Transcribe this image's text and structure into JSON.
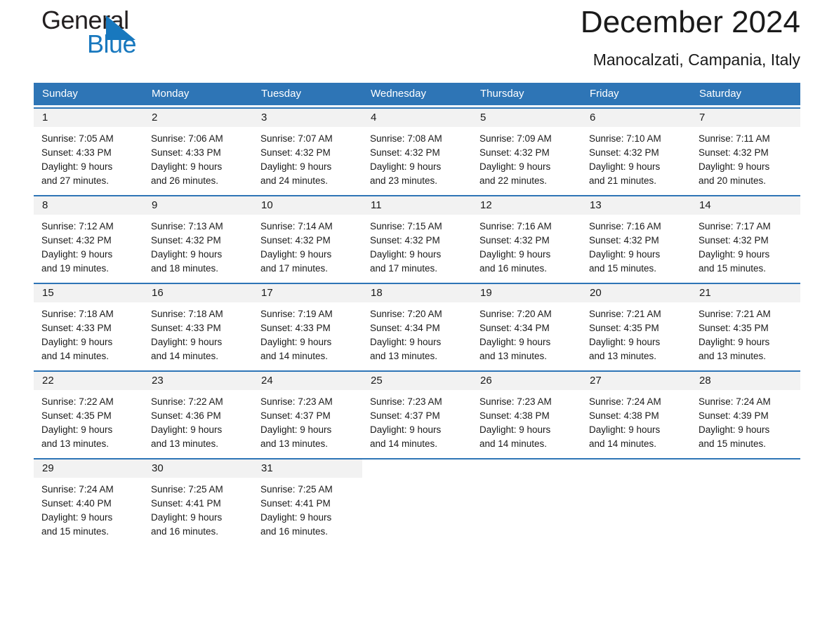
{
  "logo": {
    "text_primary": "General",
    "text_secondary": "Blue",
    "triangle_color": "#1878be",
    "primary_color": "#231f20",
    "secondary_color": "#1878be"
  },
  "header": {
    "title": "December 2024",
    "subtitle": "Manocalzati, Campania, Italy"
  },
  "theme": {
    "header_bar_color": "#2e75b6",
    "row_rule_color": "#2e75b6",
    "daynum_band_color": "#f2f2f2",
    "text_color": "#1a1a1a"
  },
  "calendar": {
    "weekday_headers": [
      "Sunday",
      "Monday",
      "Tuesday",
      "Wednesday",
      "Thursday",
      "Friday",
      "Saturday"
    ],
    "weeks": [
      [
        {
          "day": "1",
          "lines": [
            "Sunrise: 7:05 AM",
            "Sunset: 4:33 PM",
            "Daylight: 9 hours",
            "and 27 minutes."
          ]
        },
        {
          "day": "2",
          "lines": [
            "Sunrise: 7:06 AM",
            "Sunset: 4:33 PM",
            "Daylight: 9 hours",
            "and 26 minutes."
          ]
        },
        {
          "day": "3",
          "lines": [
            "Sunrise: 7:07 AM",
            "Sunset: 4:32 PM",
            "Daylight: 9 hours",
            "and 24 minutes."
          ]
        },
        {
          "day": "4",
          "lines": [
            "Sunrise: 7:08 AM",
            "Sunset: 4:32 PM",
            "Daylight: 9 hours",
            "and 23 minutes."
          ]
        },
        {
          "day": "5",
          "lines": [
            "Sunrise: 7:09 AM",
            "Sunset: 4:32 PM",
            "Daylight: 9 hours",
            "and 22 minutes."
          ]
        },
        {
          "day": "6",
          "lines": [
            "Sunrise: 7:10 AM",
            "Sunset: 4:32 PM",
            "Daylight: 9 hours",
            "and 21 minutes."
          ]
        },
        {
          "day": "7",
          "lines": [
            "Sunrise: 7:11 AM",
            "Sunset: 4:32 PM",
            "Daylight: 9 hours",
            "and 20 minutes."
          ]
        }
      ],
      [
        {
          "day": "8",
          "lines": [
            "Sunrise: 7:12 AM",
            "Sunset: 4:32 PM",
            "Daylight: 9 hours",
            "and 19 minutes."
          ]
        },
        {
          "day": "9",
          "lines": [
            "Sunrise: 7:13 AM",
            "Sunset: 4:32 PM",
            "Daylight: 9 hours",
            "and 18 minutes."
          ]
        },
        {
          "day": "10",
          "lines": [
            "Sunrise: 7:14 AM",
            "Sunset: 4:32 PM",
            "Daylight: 9 hours",
            "and 17 minutes."
          ]
        },
        {
          "day": "11",
          "lines": [
            "Sunrise: 7:15 AM",
            "Sunset: 4:32 PM",
            "Daylight: 9 hours",
            "and 17 minutes."
          ]
        },
        {
          "day": "12",
          "lines": [
            "Sunrise: 7:16 AM",
            "Sunset: 4:32 PM",
            "Daylight: 9 hours",
            "and 16 minutes."
          ]
        },
        {
          "day": "13",
          "lines": [
            "Sunrise: 7:16 AM",
            "Sunset: 4:32 PM",
            "Daylight: 9 hours",
            "and 15 minutes."
          ]
        },
        {
          "day": "14",
          "lines": [
            "Sunrise: 7:17 AM",
            "Sunset: 4:32 PM",
            "Daylight: 9 hours",
            "and 15 minutes."
          ]
        }
      ],
      [
        {
          "day": "15",
          "lines": [
            "Sunrise: 7:18 AM",
            "Sunset: 4:33 PM",
            "Daylight: 9 hours",
            "and 14 minutes."
          ]
        },
        {
          "day": "16",
          "lines": [
            "Sunrise: 7:18 AM",
            "Sunset: 4:33 PM",
            "Daylight: 9 hours",
            "and 14 minutes."
          ]
        },
        {
          "day": "17",
          "lines": [
            "Sunrise: 7:19 AM",
            "Sunset: 4:33 PM",
            "Daylight: 9 hours",
            "and 14 minutes."
          ]
        },
        {
          "day": "18",
          "lines": [
            "Sunrise: 7:20 AM",
            "Sunset: 4:34 PM",
            "Daylight: 9 hours",
            "and 13 minutes."
          ]
        },
        {
          "day": "19",
          "lines": [
            "Sunrise: 7:20 AM",
            "Sunset: 4:34 PM",
            "Daylight: 9 hours",
            "and 13 minutes."
          ]
        },
        {
          "day": "20",
          "lines": [
            "Sunrise: 7:21 AM",
            "Sunset: 4:35 PM",
            "Daylight: 9 hours",
            "and 13 minutes."
          ]
        },
        {
          "day": "21",
          "lines": [
            "Sunrise: 7:21 AM",
            "Sunset: 4:35 PM",
            "Daylight: 9 hours",
            "and 13 minutes."
          ]
        }
      ],
      [
        {
          "day": "22",
          "lines": [
            "Sunrise: 7:22 AM",
            "Sunset: 4:35 PM",
            "Daylight: 9 hours",
            "and 13 minutes."
          ]
        },
        {
          "day": "23",
          "lines": [
            "Sunrise: 7:22 AM",
            "Sunset: 4:36 PM",
            "Daylight: 9 hours",
            "and 13 minutes."
          ]
        },
        {
          "day": "24",
          "lines": [
            "Sunrise: 7:23 AM",
            "Sunset: 4:37 PM",
            "Daylight: 9 hours",
            "and 13 minutes."
          ]
        },
        {
          "day": "25",
          "lines": [
            "Sunrise: 7:23 AM",
            "Sunset: 4:37 PM",
            "Daylight: 9 hours",
            "and 14 minutes."
          ]
        },
        {
          "day": "26",
          "lines": [
            "Sunrise: 7:23 AM",
            "Sunset: 4:38 PM",
            "Daylight: 9 hours",
            "and 14 minutes."
          ]
        },
        {
          "day": "27",
          "lines": [
            "Sunrise: 7:24 AM",
            "Sunset: 4:38 PM",
            "Daylight: 9 hours",
            "and 14 minutes."
          ]
        },
        {
          "day": "28",
          "lines": [
            "Sunrise: 7:24 AM",
            "Sunset: 4:39 PM",
            "Daylight: 9 hours",
            "and 15 minutes."
          ]
        }
      ],
      [
        {
          "day": "29",
          "lines": [
            "Sunrise: 7:24 AM",
            "Sunset: 4:40 PM",
            "Daylight: 9 hours",
            "and 15 minutes."
          ]
        },
        {
          "day": "30",
          "lines": [
            "Sunrise: 7:25 AM",
            "Sunset: 4:41 PM",
            "Daylight: 9 hours",
            "and 16 minutes."
          ]
        },
        {
          "day": "31",
          "lines": [
            "Sunrise: 7:25 AM",
            "Sunset: 4:41 PM",
            "Daylight: 9 hours",
            "and 16 minutes."
          ]
        },
        {
          "day": "",
          "lines": []
        },
        {
          "day": "",
          "lines": []
        },
        {
          "day": "",
          "lines": []
        },
        {
          "day": "",
          "lines": []
        }
      ]
    ]
  }
}
